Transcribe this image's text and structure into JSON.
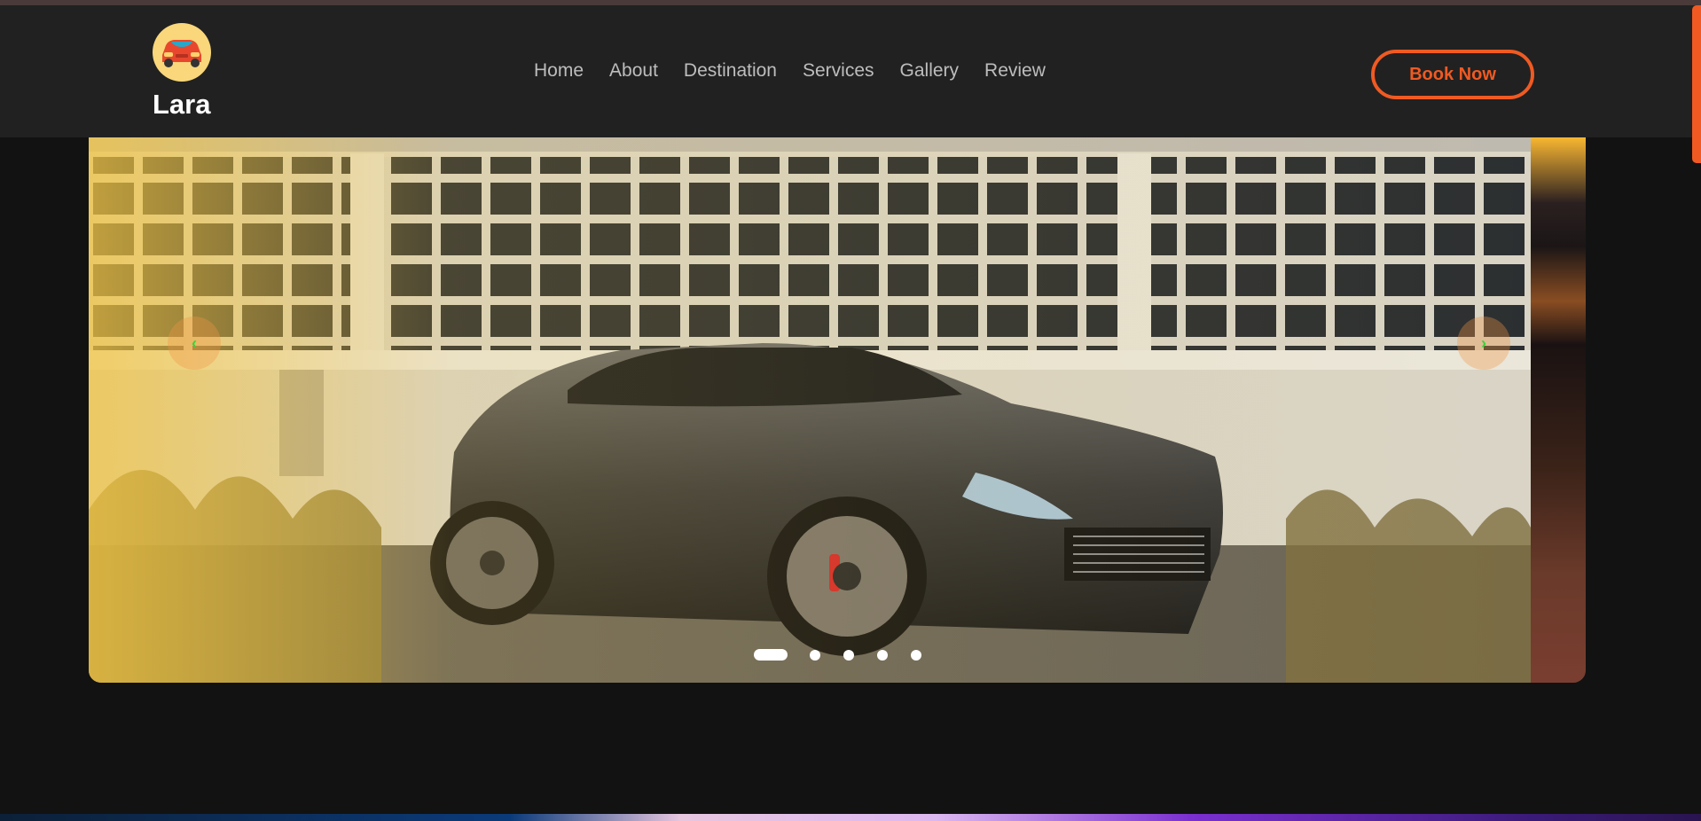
{
  "brand": {
    "name": "Lara",
    "logo_icon": "red-car-icon"
  },
  "nav": {
    "items": [
      {
        "label": "Home"
      },
      {
        "label": "About"
      },
      {
        "label": "Destination"
      },
      {
        "label": "Services"
      },
      {
        "label": "Gallery"
      },
      {
        "label": "Review"
      }
    ]
  },
  "cta": {
    "label": "Book Now"
  },
  "slider": {
    "image_subject": "dark grey sports car parked in front of a white industrial building with grid windows",
    "prev_icon": "chevron-left-icon",
    "next_icon": "chevron-right-icon",
    "prev_glyph": "‹",
    "next_glyph": "›",
    "dot_count": 5,
    "active_dot_index": 0
  },
  "colors": {
    "accent": "#f05a22",
    "navbar_bg": "#212121",
    "page_bg": "#121212",
    "nav_text": "#bdbdbd",
    "arrow_glyph": "#34d63a",
    "logo_bg": "#f9d77a"
  }
}
